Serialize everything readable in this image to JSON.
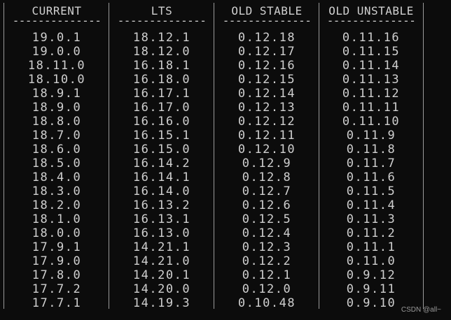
{
  "terminal": {
    "columns": [
      {
        "header": "CURRENT",
        "separator": "--------------",
        "rows": [
          "19.0.1",
          "19.0.0",
          "18.11.0",
          "18.10.0",
          "18.9.1",
          "18.9.0",
          "18.8.0",
          "18.7.0",
          "18.6.0",
          "18.5.0",
          "18.4.0",
          "18.3.0",
          "18.2.0",
          "18.1.0",
          "18.0.0",
          "17.9.1",
          "17.9.0",
          "17.8.0",
          "17.7.2",
          "17.7.1"
        ]
      },
      {
        "header": "LTS",
        "separator": "--------------",
        "rows": [
          "18.12.1",
          "18.12.0",
          "16.18.1",
          "16.18.0",
          "16.17.1",
          "16.17.0",
          "16.16.0",
          "16.15.1",
          "16.15.0",
          "16.14.2",
          "16.14.1",
          "16.14.0",
          "16.13.2",
          "16.13.1",
          "16.13.0",
          "14.21.1",
          "14.21.0",
          "14.20.1",
          "14.20.0",
          "14.19.3"
        ]
      },
      {
        "header": "OLD STABLE",
        "separator": "--------------",
        "rows": [
          "0.12.18",
          "0.12.17",
          "0.12.16",
          "0.12.15",
          "0.12.14",
          "0.12.13",
          "0.12.12",
          "0.12.11",
          "0.12.10",
          "0.12.9",
          "0.12.8",
          "0.12.7",
          "0.12.6",
          "0.12.5",
          "0.12.4",
          "0.12.3",
          "0.12.2",
          "0.12.1",
          "0.12.0",
          "0.10.48"
        ]
      },
      {
        "header": "OLD UNSTABLE",
        "separator": "--------------",
        "rows": [
          "0.11.16",
          "0.11.15",
          "0.11.14",
          "0.11.13",
          "0.11.12",
          "0.11.11",
          "0.11.10",
          "0.11.9",
          "0.11.8",
          "0.11.7",
          "0.11.6",
          "0.11.5",
          "0.11.4",
          "0.11.3",
          "0.11.2",
          "0.11.1",
          "0.11.0",
          "0.9.12",
          "0.9.11",
          "0.9.10"
        ]
      }
    ]
  },
  "watermark": "CSDN @all~",
  "colors": {
    "background": "#0c0c0c",
    "text": "#cfcfcf",
    "border": "#9a9a9a"
  }
}
